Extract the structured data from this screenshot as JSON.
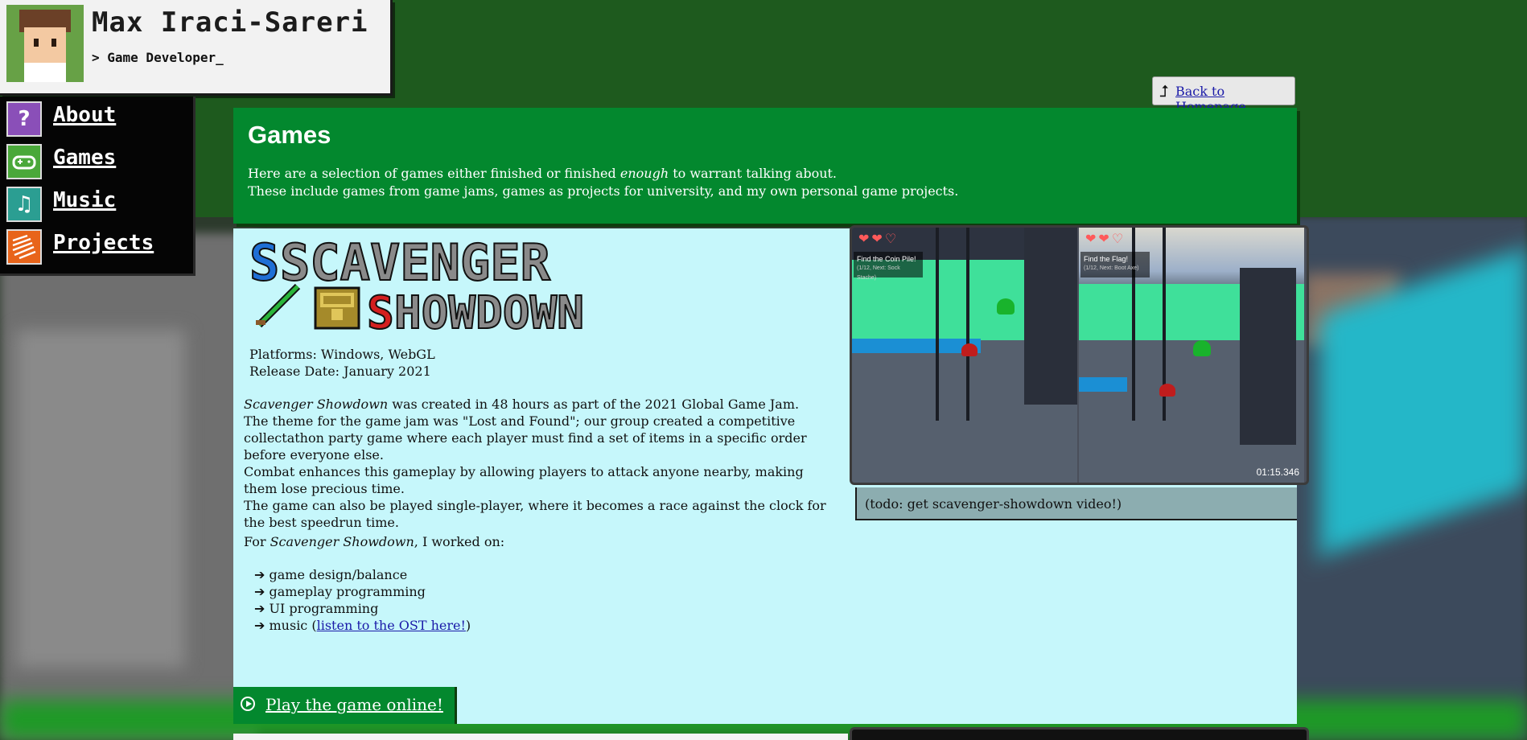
{
  "header": {
    "name": "Max Iraci-Sareri",
    "subtitle": "> Game Developer_"
  },
  "nav": {
    "items": [
      {
        "label": "About",
        "icon": "question-icon",
        "color": "#8a4fb8"
      },
      {
        "label": "Games",
        "icon": "gamepad-icon",
        "color": "#4aa83a"
      },
      {
        "label": "Music",
        "icon": "music-note-icon",
        "color": "#2b9e92"
      },
      {
        "label": "Projects",
        "icon": "document-icon",
        "color": "#e8641a"
      }
    ]
  },
  "back_link": {
    "label": "Back to Homepage",
    "icon": "up-arrow-icon"
  },
  "games": {
    "title": "Games",
    "intro_pre": "Here are a selection of games either finished or finished ",
    "intro_em": "enough",
    "intro_post": " to warrant talking about.",
    "intro_line2": "These include games from game jams, games as projects for university, and my own personal game projects."
  },
  "game": {
    "logo_line1": "SCAVENGER",
    "logo_line2": "SHOWDOWN",
    "platforms": "Platforms: Windows, WebGL",
    "release": "Release Date: January 2021",
    "title_em": "Scavenger Showdown",
    "desc_line1_rest": " was created in 48 hours as part of the 2021 Global Game Jam.",
    "desc_p2": "The theme for the game jam was \"Lost and Found\"; our group created a competitive collectathon party game where each player must find a set of items in a specific order before everyone else.",
    "desc_p3": "Combat enhances this gameplay by allowing players to attack anyone nearby, making them lose precious time.",
    "desc_p4": "The game can also be played single-player, where it becomes a race against the clock for the best speedrun time.",
    "worked_pre": "For ",
    "worked_post": ", I worked on:",
    "bullets": [
      "game design/balance",
      "gameplay programming",
      "UI programming"
    ],
    "music_pre": "music (",
    "music_link": "listen to the OST here!",
    "music_post": ")",
    "play_label": "Play the game online!",
    "play_icon": "play-circle-icon",
    "caption": "(todo: get scavenger-showdown video!)"
  },
  "screenshot": {
    "left_objective": "Find the Coin Pile!",
    "left_objective_sub": "(1/12, Next: Sock Stache)",
    "right_objective": "Find the Flag!",
    "right_objective_sub": "(1/12, Next: Boot Axe)",
    "hearts": "❤❤♡",
    "timer": "01:15.346"
  },
  "colors": {
    "page_green": "#1e5a1e",
    "panel_green": "#03882e",
    "card_cyan": "#c6f7fb",
    "link_blue": "#1a1aa8"
  }
}
